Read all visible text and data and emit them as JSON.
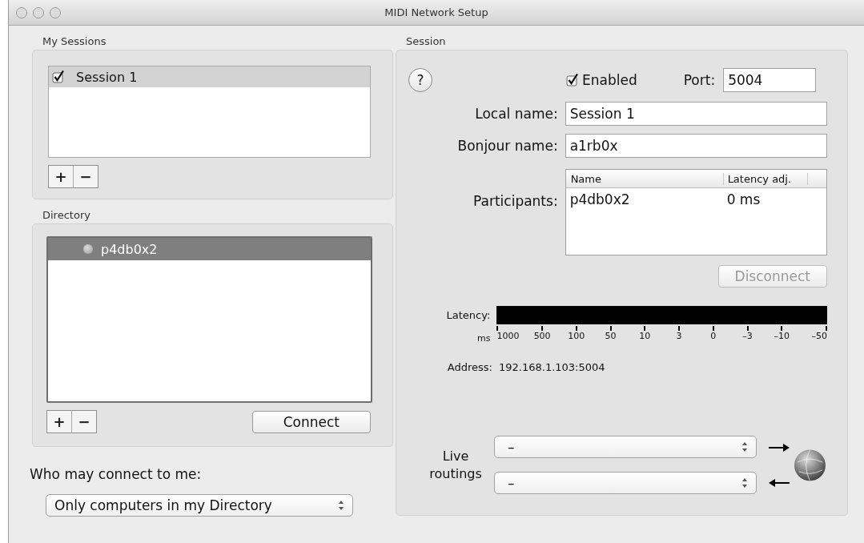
{
  "window": {
    "title": "MIDI Network Setup"
  },
  "my_sessions": {
    "label": "My Sessions",
    "sessions": [
      {
        "name": "Session 1",
        "enabled": true,
        "selected": true
      }
    ],
    "add_button": "+",
    "remove_button": "−"
  },
  "directory": {
    "label": "Directory",
    "items": [
      {
        "name": "p4db0x2",
        "selected": true
      }
    ],
    "add_button": "+",
    "remove_button": "−",
    "connect_button": "Connect"
  },
  "who_may_connect": {
    "label": "Who may connect to me:",
    "value": "Only computers in my Directory"
  },
  "session": {
    "label": "Session",
    "help_button": "?",
    "enabled": {
      "label": "Enabled",
      "checked": true
    },
    "port": {
      "label": "Port:",
      "value": "5004"
    },
    "local_name": {
      "label": "Local name:",
      "value": "Session 1"
    },
    "bonjour_name": {
      "label": "Bonjour name:",
      "value": "a1rb0x"
    },
    "participants": {
      "label": "Participants:",
      "columns": [
        "Name",
        "Latency adj."
      ],
      "rows": [
        [
          "p4db0x2",
          "0 ms"
        ]
      ]
    },
    "disconnect_button": {
      "label": "Disconnect",
      "disabled": true
    },
    "latency": {
      "label": "Latency:",
      "unit": "ms",
      "ticks": [
        "1000",
        "500",
        "100",
        "50",
        "10",
        "3",
        "0",
        "–3",
        "–10",
        "–50"
      ]
    },
    "address": {
      "label": "Address:",
      "value": "192.168.1.103:5004"
    },
    "live_routings": {
      "label": "Live routings",
      "outputs": [
        {
          "value": "–",
          "kind": "out"
        },
        {
          "value": "–",
          "kind": "in"
        }
      ]
    }
  }
}
